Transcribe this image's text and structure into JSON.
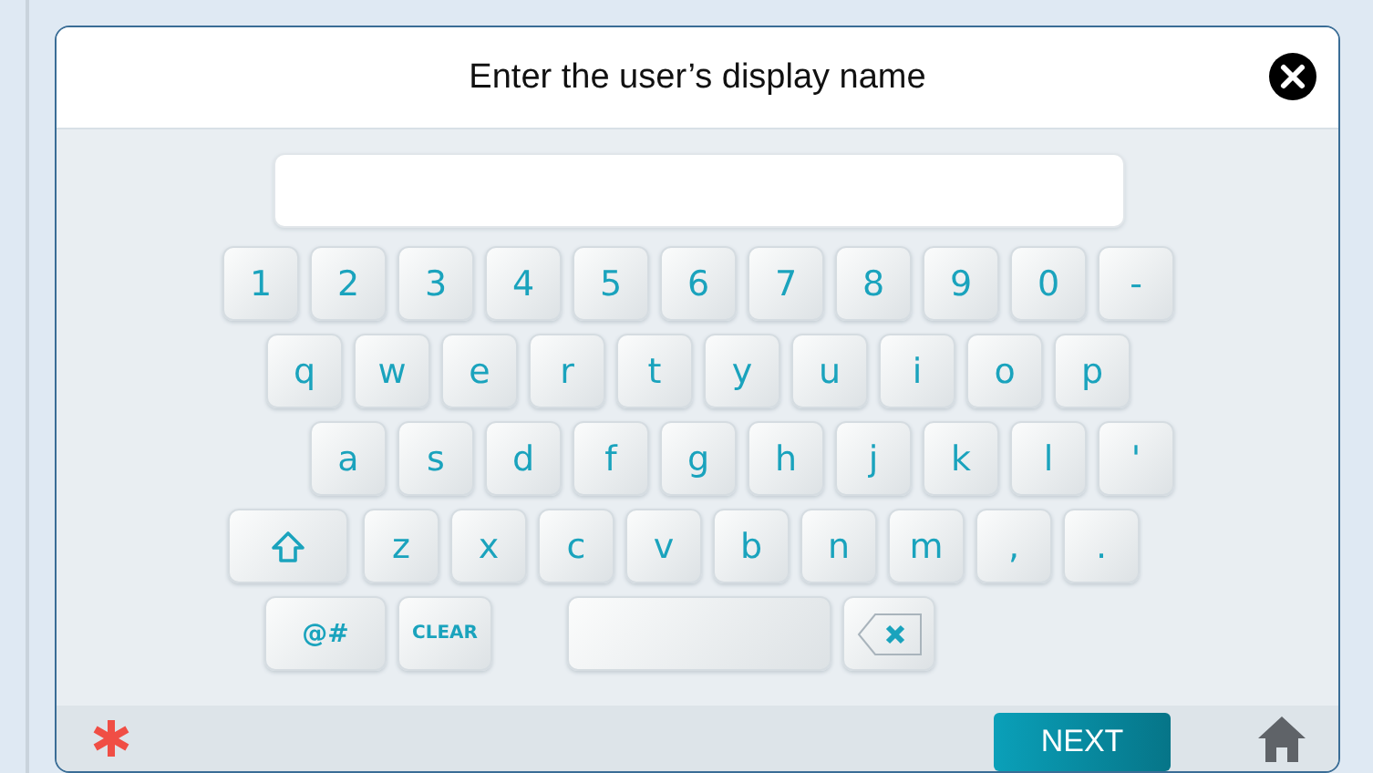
{
  "dialog": {
    "title": "Enter the user’s display name"
  },
  "keyboard": {
    "rows": [
      {
        "keys": [
          {
            "kind": "key",
            "label": "1"
          },
          {
            "kind": "key",
            "label": "2"
          },
          {
            "kind": "key",
            "label": "3"
          },
          {
            "kind": "key",
            "label": "4"
          },
          {
            "kind": "key",
            "label": "5"
          },
          {
            "kind": "key",
            "label": "6"
          },
          {
            "kind": "key",
            "label": "7"
          },
          {
            "kind": "key",
            "label": "8"
          },
          {
            "kind": "key",
            "label": "9"
          },
          {
            "kind": "key",
            "label": "0"
          },
          {
            "kind": "key",
            "label": "-"
          }
        ]
      },
      {
        "keys": [
          {
            "kind": "key",
            "label": "q"
          },
          {
            "kind": "key",
            "label": "w"
          },
          {
            "kind": "key",
            "label": "e"
          },
          {
            "kind": "key",
            "label": "r"
          },
          {
            "kind": "key",
            "label": "t"
          },
          {
            "kind": "key",
            "label": "y"
          },
          {
            "kind": "key",
            "label": "u"
          },
          {
            "kind": "key",
            "label": "i"
          },
          {
            "kind": "key",
            "label": "o"
          },
          {
            "kind": "key",
            "label": "p"
          }
        ]
      },
      {
        "keys": [
          {
            "kind": "key",
            "label": "a"
          },
          {
            "kind": "key",
            "label": "s"
          },
          {
            "kind": "key",
            "label": "d"
          },
          {
            "kind": "key",
            "label": "f"
          },
          {
            "kind": "key",
            "label": "g"
          },
          {
            "kind": "key",
            "label": "h"
          },
          {
            "kind": "key",
            "label": "j"
          },
          {
            "kind": "key",
            "label": "k"
          },
          {
            "kind": "key",
            "label": "l"
          },
          {
            "kind": "key",
            "label": "'"
          }
        ]
      },
      {
        "keys": [
          {
            "kind": "shift"
          },
          {
            "kind": "key",
            "label": "z"
          },
          {
            "kind": "key",
            "label": "x"
          },
          {
            "kind": "key",
            "label": "c"
          },
          {
            "kind": "key",
            "label": "v"
          },
          {
            "kind": "key",
            "label": "b"
          },
          {
            "kind": "key",
            "label": "n"
          },
          {
            "kind": "key",
            "label": "m"
          },
          {
            "kind": "key",
            "label": ","
          },
          {
            "kind": "key",
            "label": "."
          }
        ]
      },
      {
        "keys": [
          {
            "kind": "wide",
            "label": "@#"
          },
          {
            "kind": "small",
            "label": "CLEAR"
          },
          {
            "kind": "space"
          },
          {
            "kind": "backspace"
          }
        ]
      }
    ]
  },
  "footer": {
    "next_button": "NEXT"
  }
}
